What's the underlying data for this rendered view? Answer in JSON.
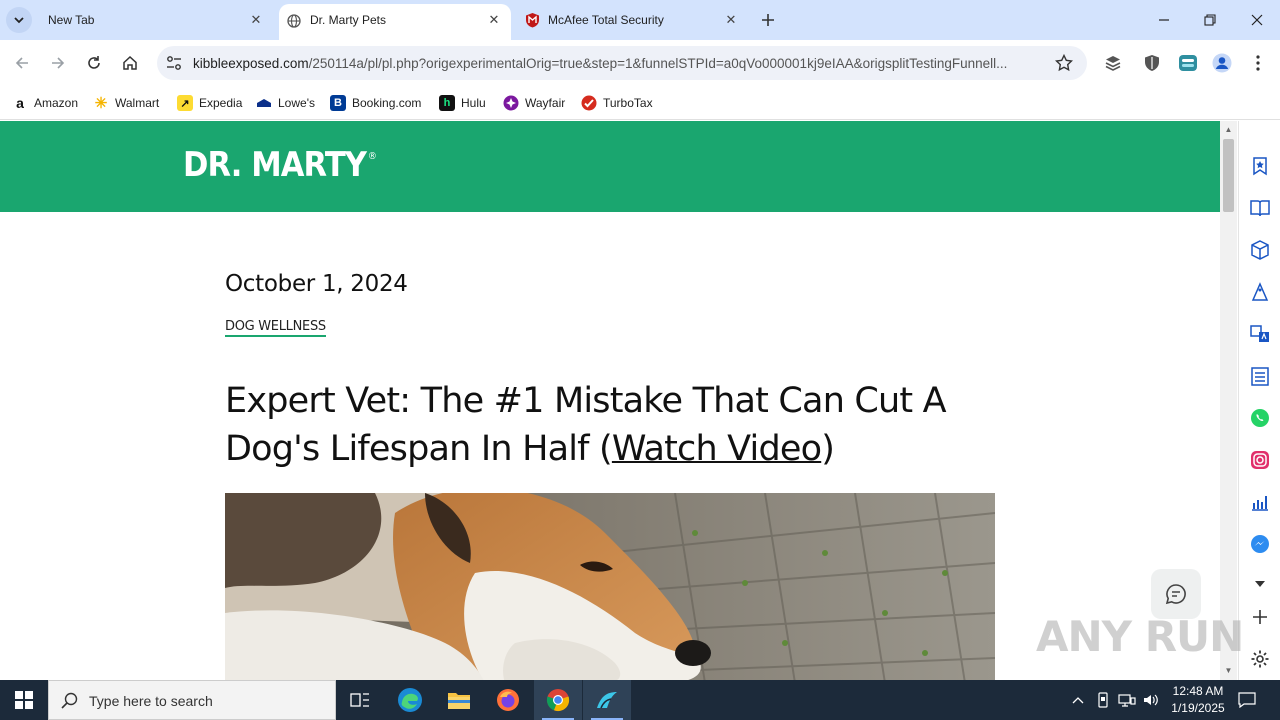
{
  "browser": {
    "tabs": [
      {
        "title": "New Tab",
        "active": false
      },
      {
        "title": "Dr. Marty Pets",
        "active": true
      },
      {
        "title": "McAfee Total Security",
        "active": false
      }
    ],
    "url_host": "kibbleexposed.com",
    "url_path": "/250114a/pl/pl.php?origexperimentalOrig=true&step=1&funnelSTPId=a0qVo000001kj9eIAA&origsplitTestingFunnell...",
    "bookmarks": [
      "Amazon",
      "Walmart",
      "Expedia",
      "Lowe's",
      "Booking.com",
      "Hulu",
      "Wayfair",
      "TurboTax"
    ]
  },
  "page": {
    "logo": "DR. MARTY",
    "logo_mark": "®",
    "date": "October 1, 2024",
    "category": "DOG WELLNESS",
    "headline_prefix": "Expert Vet: The #1 Mistake That Can Cut A Dog's Lifespan In Half (",
    "headline_link": "Watch Video",
    "headline_suffix": ")",
    "brand_color": "#1aa66f"
  },
  "watermark": "ANY RUN",
  "taskbar": {
    "search_placeholder": "Type here to search",
    "time": "12:48 AM",
    "date": "1/19/2025"
  }
}
